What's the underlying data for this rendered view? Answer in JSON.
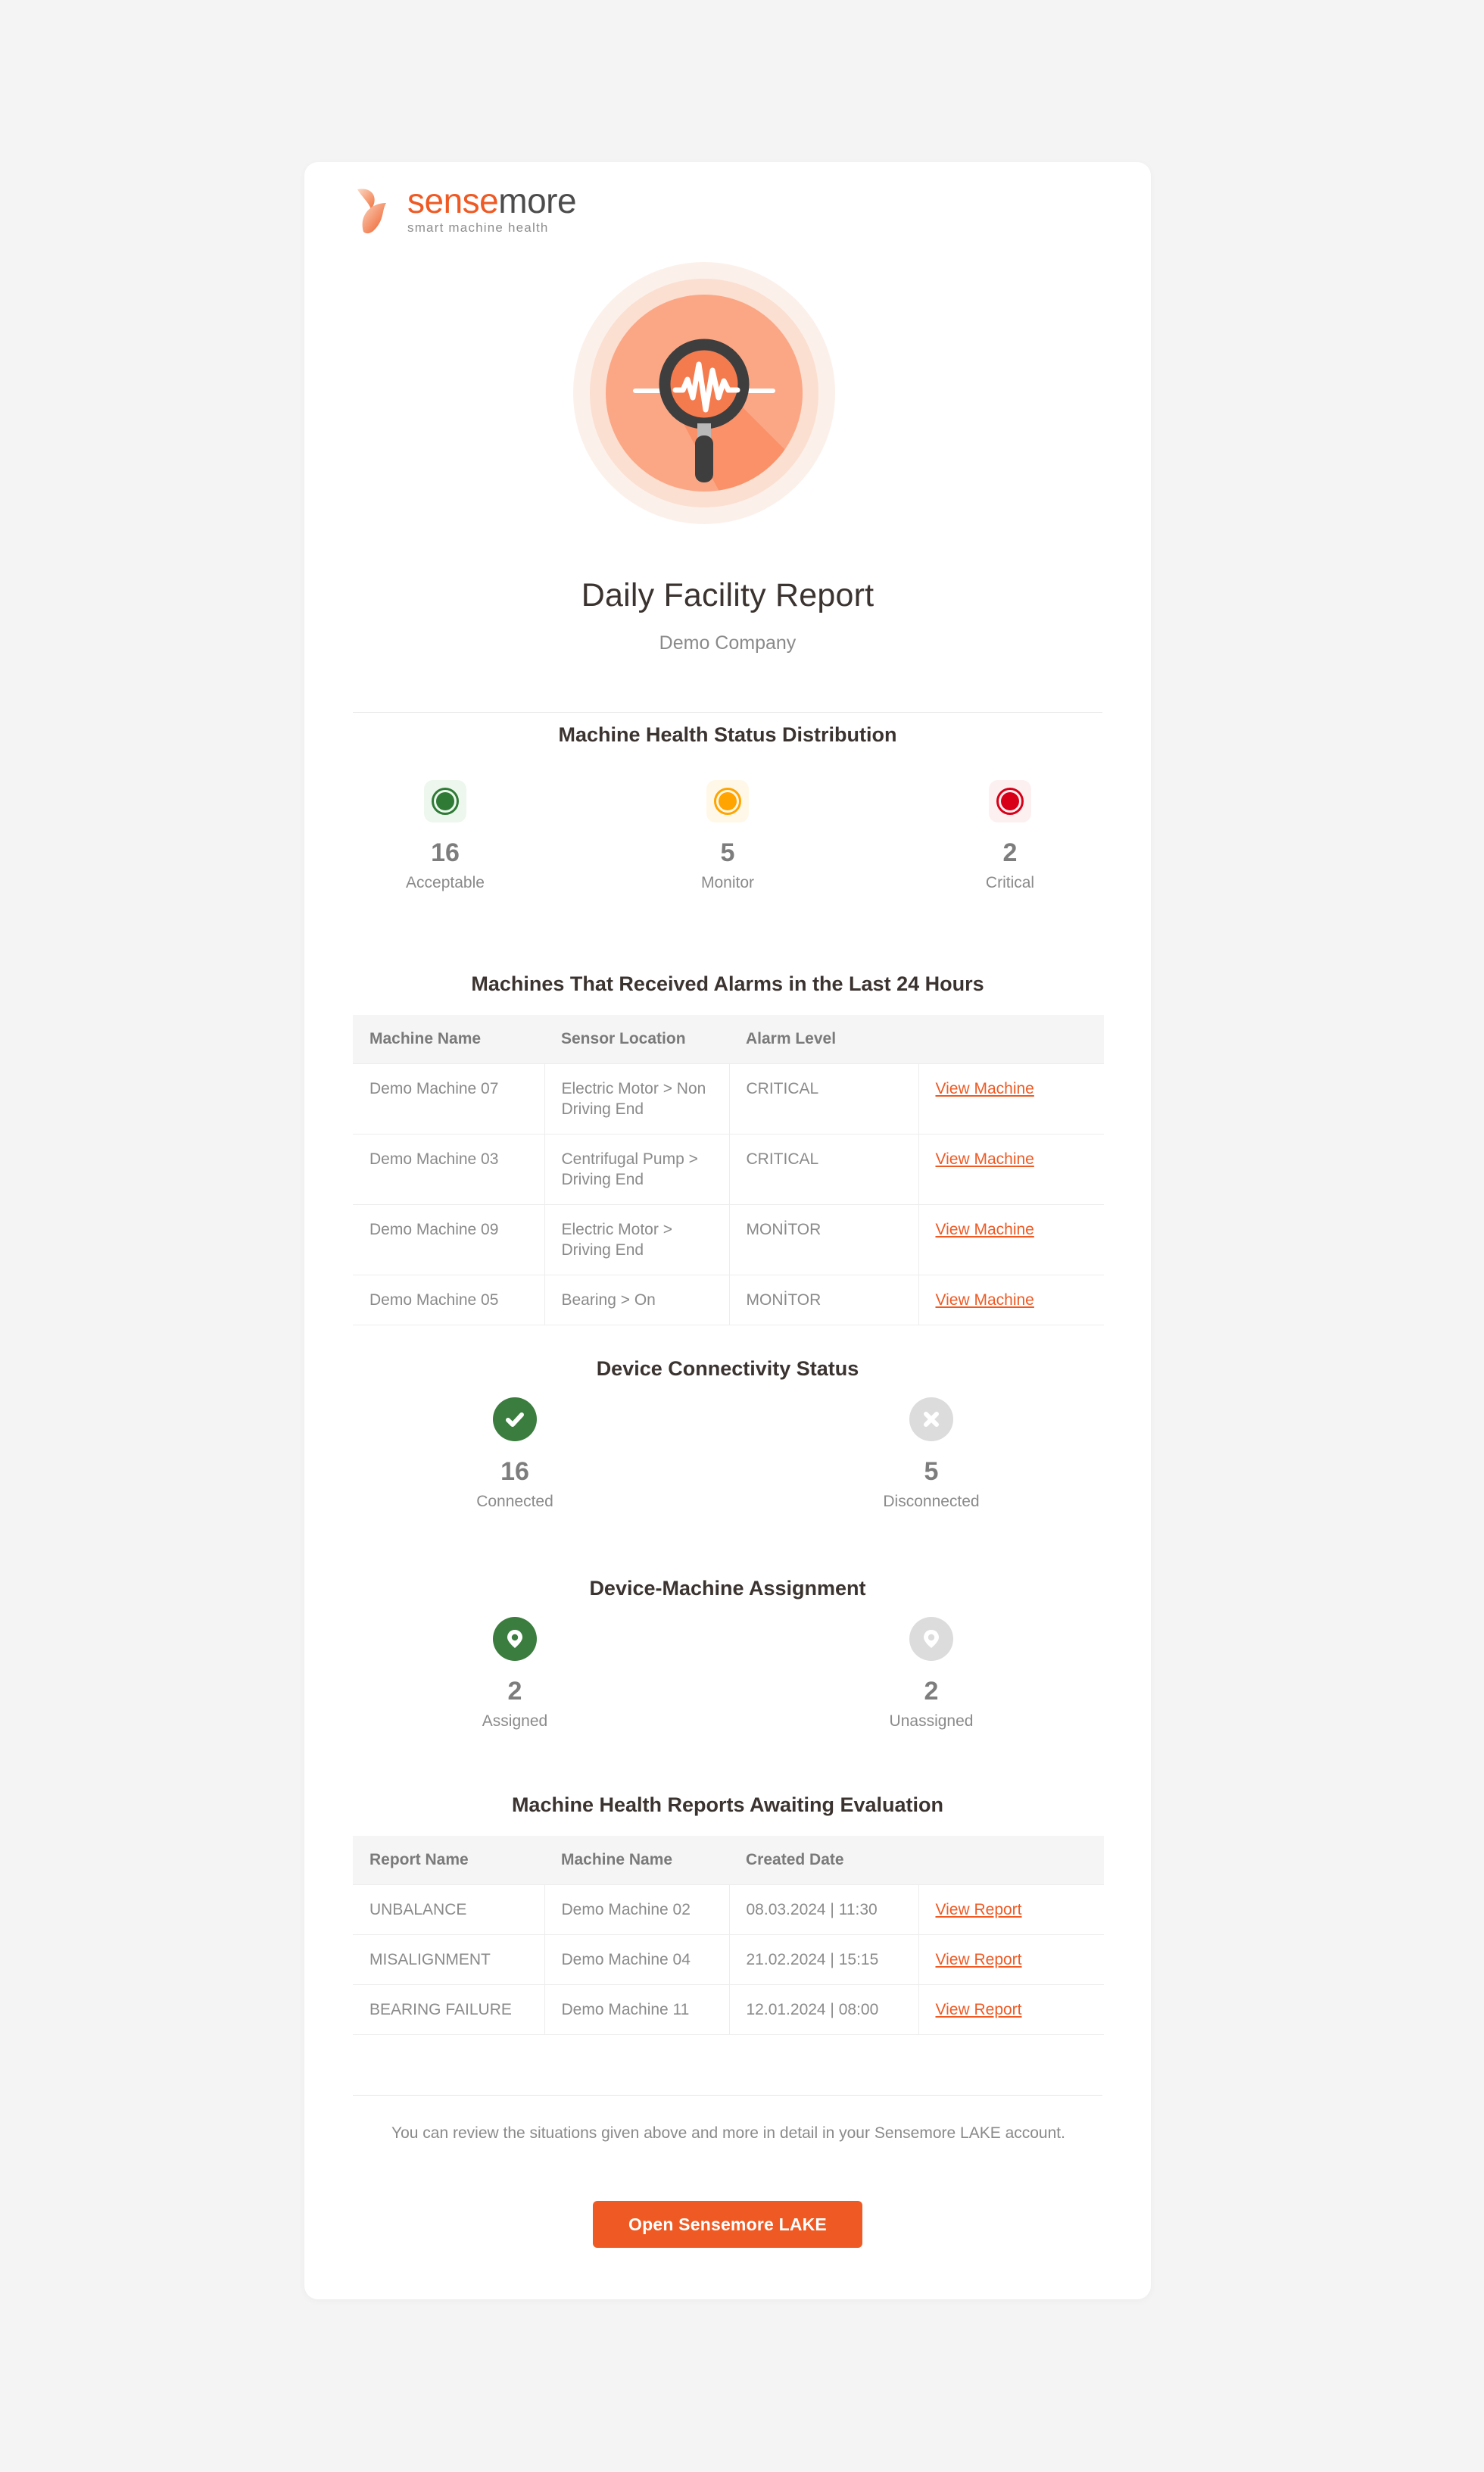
{
  "brand": {
    "logo_word_primary": "sense",
    "logo_word_secondary": "more",
    "logo_tagline": "smart machine health",
    "accent_color": "#ef5a24",
    "logo_icon": "sensemore-swoosh-mark",
    "hero_icon": "magnifier-waveform-icon"
  },
  "header": {
    "title": "Daily Facility Report",
    "company": "Demo Company"
  },
  "health_status": {
    "section_title": "Machine Health Status Distribution",
    "items": [
      {
        "value": "16",
        "label": "Acceptable",
        "color": "#2f7b36",
        "bg": "#edf7ee",
        "icon": "status-dot-acceptable-icon"
      },
      {
        "value": "5",
        "label": "Monitor",
        "color": "#ffa400",
        "bg": "#fff8e8",
        "icon": "status-dot-monitor-icon"
      },
      {
        "value": "2",
        "label": "Critical",
        "color": "#d80019",
        "bg": "#fdf0f1",
        "icon": "status-dot-critical-icon"
      }
    ]
  },
  "alarms": {
    "section_title": "Machines That Received Alarms in the Last 24 Hours",
    "columns": [
      "Machine Name",
      "Sensor Location",
      "Alarm Level",
      ""
    ],
    "rows": [
      {
        "machine": "Demo Machine 07",
        "sensor": "Electric Motor > Non Driving End",
        "level": "CRITICAL",
        "level_type": "critical",
        "action": "View Machine"
      },
      {
        "machine": "Demo Machine 03",
        "sensor": "Centrifugal Pump > Driving End",
        "level": "CRITICAL",
        "level_type": "critical",
        "action": "View Machine"
      },
      {
        "machine": "Demo Machine 09",
        "sensor": "Electric Motor > Driving End",
        "level": "MONİTOR",
        "level_type": "monitor",
        "action": "View Machine"
      },
      {
        "machine": "Demo Machine 05",
        "sensor": "Bearing > On",
        "level": "MONİTOR",
        "level_type": "monitor",
        "action": "View Machine"
      }
    ]
  },
  "connectivity": {
    "section_title": "Device Connectivity Status",
    "items": [
      {
        "value": "16",
        "label": "Connected",
        "icon": "check-circle-icon",
        "state": "green"
      },
      {
        "value": "5",
        "label": "Disconnected",
        "icon": "x-circle-icon",
        "state": "gray"
      }
    ]
  },
  "assignment": {
    "section_title": "Device-Machine Assignment",
    "items": [
      {
        "value": "2",
        "label": "Assigned",
        "icon": "map-pin-icon",
        "state": "green"
      },
      {
        "value": "2",
        "label": "Unassigned",
        "icon": "map-pin-icon",
        "state": "gray"
      }
    ]
  },
  "reports": {
    "section_title": "Machine Health Reports Awaiting Evaluation",
    "columns": [
      "Report Name",
      "Machine Name",
      "Created Date",
      ""
    ],
    "rows": [
      {
        "report": "UNBALANCE",
        "machine": "Demo Machine 02",
        "created": "08.03.2024 | 11:30",
        "action": "View Report"
      },
      {
        "report": "MISALIGNMENT",
        "machine": "Demo Machine 04",
        "created": "21.02.2024 | 15:15",
        "action": "View Report"
      },
      {
        "report": "BEARING FAILURE",
        "machine": "Demo Machine 11",
        "created": "12.01.2024 | 08:00",
        "action": "View Report"
      }
    ]
  },
  "footer": {
    "note": "You can review the situations given above and more in detail in your Sensemore LAKE account.",
    "cta_label": "Open Sensemore LAKE"
  }
}
